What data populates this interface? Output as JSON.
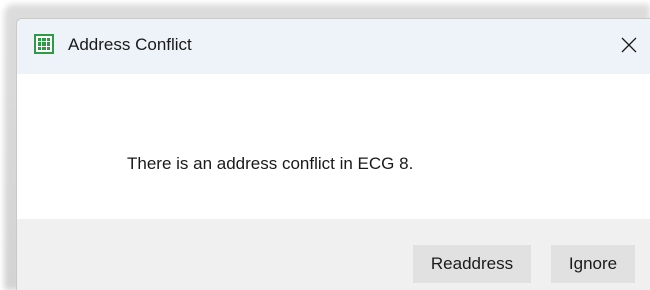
{
  "dialog": {
    "title": "Address Conflict",
    "app_icon": "green-grid-app-icon",
    "close_icon": "close-icon",
    "message": "There is an address conflict in ECG 8."
  },
  "buttons": {
    "readdress_label": "Readdress",
    "ignore_label": "Ignore"
  },
  "colors": {
    "titlebar_bg": "#edf3f9",
    "footer_bg": "#f0f0f0",
    "button_bg": "#e1e1e1",
    "icon_green": "#2f9a45"
  }
}
